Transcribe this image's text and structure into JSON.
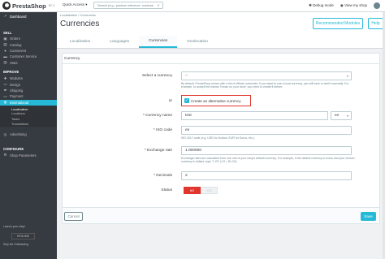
{
  "topbar": {
    "logo_text": "PrestaShop",
    "version": "1.7.6",
    "collapse_icon": "double-chevron-left-icon",
    "quick_access": "Quick Access ▾",
    "search_placeholder": "Search (e.g.: product reference, custome",
    "debug_mode": "Debug mode",
    "view_shop": "View my shop"
  },
  "sidebar": {
    "dashboard": "Dashboard",
    "sections": [
      {
        "heading": "SELL",
        "items": [
          "Orders",
          "Catalog",
          "Customers",
          "Customer Service",
          "Stats"
        ]
      },
      {
        "heading": "IMPROVE",
        "items": [
          "Modules",
          "Design",
          "Shipping",
          "Payment",
          "International"
        ]
      }
    ],
    "international_sub": [
      "Localization",
      "Locations",
      "Taxes",
      "Translations"
    ],
    "after": [
      "Advertising"
    ],
    "configure": {
      "heading": "CONFIGURE",
      "items": [
        "Shop Parameters"
      ]
    },
    "footer_text": "Launch your shop!",
    "footer_button": "RESUME",
    "footer_link": "Stop the OnBoarding"
  },
  "header": {
    "breadcrumb": "Localization  /  Currencies",
    "title": "Currencies",
    "recommended": "Recommended Modules",
    "help": "Help",
    "tabs": [
      "Localization",
      "Languages",
      "Currencies",
      "Geolocation"
    ],
    "active_tab": 2
  },
  "form": {
    "panel_title": "Currency",
    "select_label": "Select a currency",
    "select_value": "--",
    "select_help": "By default, PrestaShop comes with a list of official currencies. If you want to use a local currency, you will have to add it manually. For example, to accept the Iranian Toman on your store, you need to create it before.",
    "or": "or",
    "alt_label": "Create an alternative currency",
    "name_label": "* Currency name",
    "name_value": "test",
    "name_lang": "en",
    "iso_label": "* ISO code",
    "iso_value": "en",
    "iso_help": "ISO 4217 code (e.g. USD for Dollars, EUR for Euros, etc.).",
    "rate_label": "* Exchange rate",
    "rate_value": "1.000000",
    "rate_help": "Exchange rates are calculated from one unit of your shop's default currency. For example, if the default currency is euros and your chosen currency is dollars, type \"1.20\" (1 € = $1.20).",
    "decimals_label": "* Decimals",
    "decimals_value": "2",
    "status_label": "Status",
    "status_no": "NO",
    "status_yes": "YES",
    "cancel": "Cancel",
    "save": "Save"
  }
}
